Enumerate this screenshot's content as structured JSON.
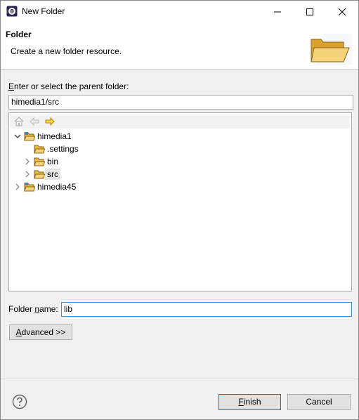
{
  "window": {
    "title": "New Folder"
  },
  "header": {
    "title": "Folder",
    "description": "Create a new folder resource."
  },
  "parent": {
    "label_pre": "E",
    "label_rest": "nter or select the parent folder:",
    "value": "himedia1/src"
  },
  "tree": {
    "items": [
      {
        "label": "himedia1",
        "expanded": true,
        "level": 0
      },
      {
        "label": ".settings",
        "level": 1
      },
      {
        "label": "bin",
        "level": 1
      },
      {
        "label": "src",
        "level": 1,
        "selected": true
      },
      {
        "label": "himedia45",
        "level": 0
      }
    ]
  },
  "folder_name": {
    "label_pre": "Folder ",
    "label_mnemonic": "n",
    "label_rest": "ame:",
    "value": "lib"
  },
  "buttons": {
    "advanced_mnemonic": "A",
    "advanced_rest": "dvanced >>",
    "finish_mnemonic": "F",
    "finish_rest": "inish",
    "cancel": "Cancel"
  },
  "colors": {
    "accent": "#0078d7",
    "folder": "#e8b948"
  }
}
